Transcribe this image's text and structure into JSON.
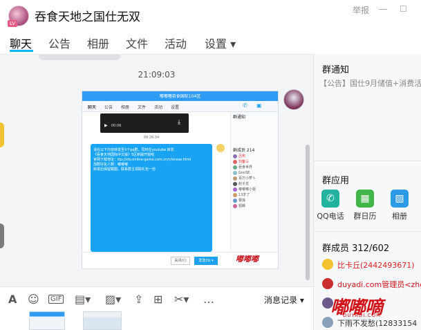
{
  "window": {
    "title": "吞食天地之国仕无双",
    "report_label": "举报",
    "minimize": "—",
    "maximize": "☐"
  },
  "tabs": [
    {
      "label": "聊天"
    },
    {
      "label": "公告"
    },
    {
      "label": "相册"
    },
    {
      "label": "文件"
    },
    {
      "label": "活动"
    },
    {
      "label": "设置 ▾"
    }
  ],
  "chat": {
    "timestamp": "21:09:03"
  },
  "embedded": {
    "title": "嘟嘟嘟吞食国际104区",
    "tabs": [
      "聊天",
      "公告",
      "相册",
      "文件",
      "活动",
      "设置"
    ],
    "time": "08:26:34",
    "video_time": "00:06",
    "blue_lines": [
      "请在以下内容转发至3个qq群，同时在youtube 转发",
      "《吞食天地国际中文版》5区新服开服啦",
      "官网下载地址：ttp://sto.online-game.com.cn/chinese.html",
      "加群好友人数：嘟嘟嘟",
      "转发后保留截图，联系群主领取礼包一份"
    ],
    "notice_label": "群通知",
    "members_label": "群成员 214",
    "members": [
      "吕布",
      "刘备三",
      "吞食世界",
      "GooSE",
      "百万小萝卜",
      "赵子龙",
      "嘟嘟嘟小姐",
      "13岁了",
      "曹操",
      "貂蝉"
    ],
    "close_btn": "关闭(C)",
    "send_btn": "发送(S) ▾",
    "watermark": "嘟嘟嘟"
  },
  "toolbar": {
    "record_label": "消息记录 ▾"
  },
  "right": {
    "notice_heading": "群通知",
    "notice_text": "【公告】国仕9月储值+消费活",
    "apps_heading": "群应用",
    "apps": [
      {
        "label": "QQ电话",
        "color": "#21b3a0"
      },
      {
        "label": "群日历",
        "color": "#43b649"
      },
      {
        "label": "相册",
        "color": "#2b9be8"
      }
    ],
    "members_heading": "群成员 312/602",
    "members": [
      {
        "name": "比卡丘(2442493671)",
        "color": "#e02020"
      },
      {
        "name": "duyadi.com管理员<zhg",
        "color": "#d11219"
      },
      {
        "name": "",
        "color": "#333"
      },
      {
        "name": "下雨不发愁(12833154",
        "color": "#333"
      }
    ],
    "logo": "嘟嘟嘀",
    "logo_sub": "DUYADI.COM"
  },
  "colors": {
    "accent": "#12b7f5",
    "bubble_blue": "#19a4f3"
  }
}
